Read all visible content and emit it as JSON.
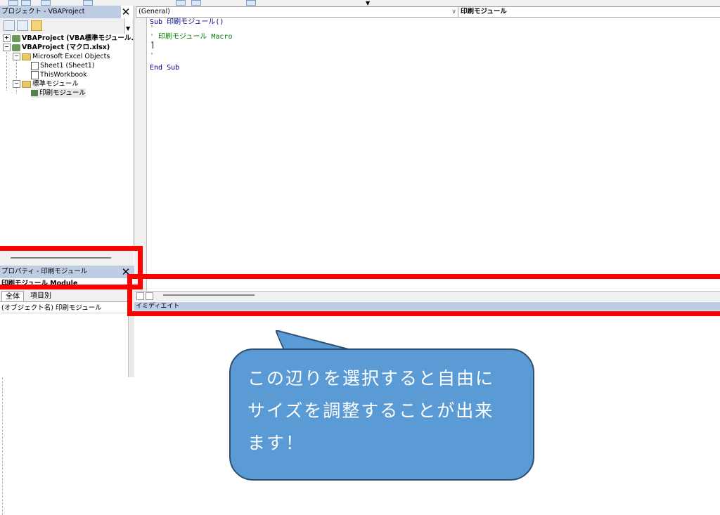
{
  "project_explorer": {
    "title": "プロジェクト - VBAProject",
    "close": "✕",
    "tree": {
      "vbaproject1": "VBAProject (VBA標準モジュール.x",
      "vbaproject2": "VBAProject (マクロ.xlsx)",
      "excel_objects": "Microsoft Excel Objects",
      "sheet1": "Sheet1 (Sheet1)",
      "thisworkbook": "ThisWorkbook",
      "modules_folder": "標準モジュール",
      "module": "印刷モジュール"
    }
  },
  "properties": {
    "title": "プロパティ - 印刷モジュール",
    "close": "✕",
    "object": "印刷モジュール Module",
    "tabs": [
      "全体",
      "項目別"
    ],
    "row": "(オブジェクト名) 印刷モジュール"
  },
  "code_window": {
    "object_combo": "(General)",
    "proc_combo": "印刷モジュール",
    "lines": {
      "l1_kw": "Sub",
      "l1_rest": " 印刷モジュール()",
      "l2": "'",
      "l3": "' 印刷モジュール Macro",
      "l4": "'",
      "l6": "'",
      "l8": "End Sub"
    }
  },
  "immediate": {
    "title": "イミディエイト"
  },
  "callout": {
    "text": "この辺りを選択すると自由に\nサイズを調整することが出来\nます！"
  },
  "colors": {
    "highlight": "#ff0000",
    "callout_fill": "#5b9bd5",
    "pane_title": "#bfcde4"
  }
}
